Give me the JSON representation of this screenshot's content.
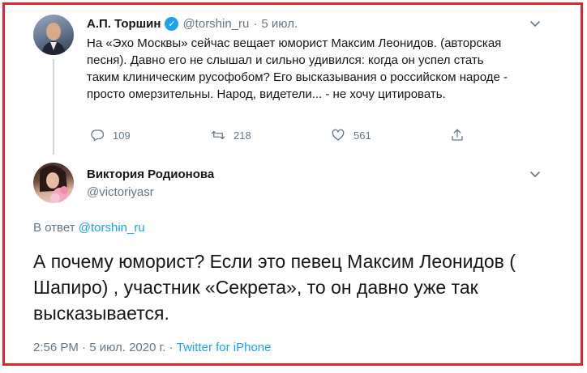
{
  "parent_tweet": {
    "author_name": "А.П. Торшин",
    "handle": "@torshin_ru",
    "separator": "·",
    "date": "5 июл.",
    "text": "На «Эхо Москвы» сейчас вещает юморист  Максим Леонидов. (авторская песня). Давно его не слышал и сильно удивился: когда он успел стать таким клиническим русофобом? Его высказывания о российском народе - просто омерзительны. Народ, видетели... - не хочу цитировать.",
    "actions": {
      "replies": "109",
      "retweets": "218",
      "likes": "561"
    },
    "icons": [
      "verified-badge-icon",
      "chevron-down-icon",
      "reply-icon",
      "retweet-icon",
      "like-icon",
      "share-icon"
    ]
  },
  "reply_tweet": {
    "author_name": "Виктория Родионова",
    "handle": "@victoriyasr",
    "reply_prefix": "В ответ",
    "reply_to_handle": "@torshin_ru",
    "text": "А почему юморист? Если это певец Максим Леонидов ( Шапиро) , участник «Секрета», то он давно уже так высказывается.",
    "timestamp": "2:56 PM · 5 июл. 2020 г. · ",
    "source": "Twitter for iPhone"
  },
  "colors": {
    "frame_border": "#e3242b",
    "link": "#1da1f2",
    "muted": "#657786",
    "text": "#14171a"
  }
}
